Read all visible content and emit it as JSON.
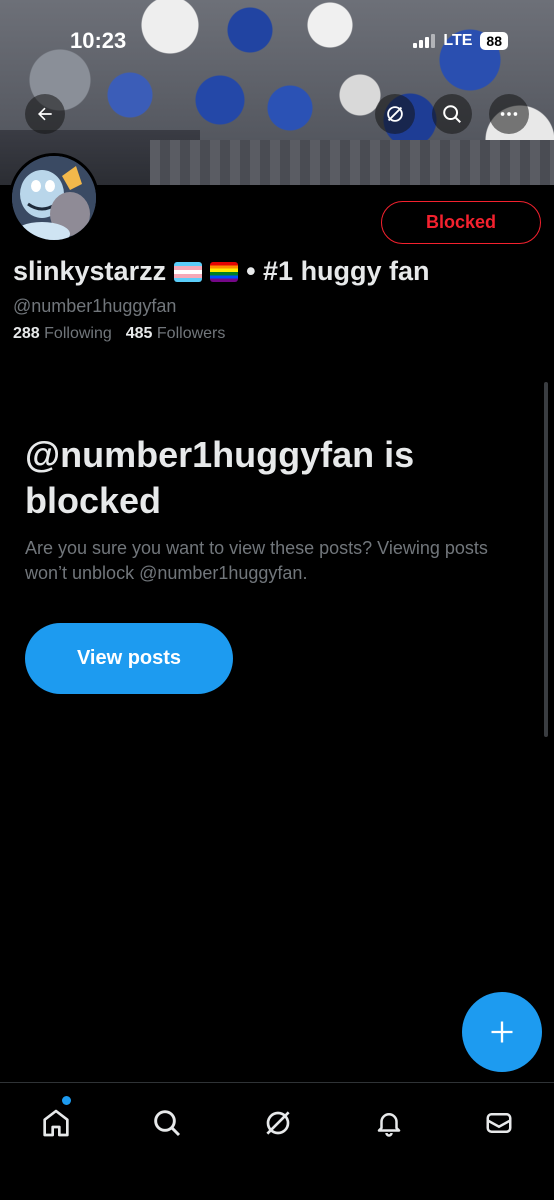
{
  "status_bar": {
    "time": "10:23",
    "network": "LTE",
    "battery": "88"
  },
  "header": {
    "back_icon": "arrow-left-icon",
    "grok_icon": "grok-slash-icon",
    "search_icon": "search-icon",
    "more_icon": "more-horizontal-icon"
  },
  "profile": {
    "display_name": "slinkystarzz",
    "name_suffix": "• #1 huggy fan",
    "flags": [
      "transgender-flag",
      "rainbow-flag"
    ],
    "handle": "@number1huggyfan",
    "following_count": "288",
    "following_label": "Following",
    "followers_count": "485",
    "followers_label": "Followers",
    "blocked_button": "Blocked"
  },
  "blocked_notice": {
    "title": "@number1huggyfan is blocked",
    "subtitle": "Are you sure you want to view these posts? Viewing posts won’t unblock @number1huggyfan.",
    "button": "View posts"
  },
  "fab": {
    "icon": "plus-icon"
  },
  "bottom_nav": {
    "items": [
      "home-icon",
      "search-icon",
      "grok-slash-icon",
      "bell-icon",
      "mail-icon"
    ],
    "home_has_dot": true
  },
  "colors": {
    "accent": "#1d9bf0",
    "danger": "#f4212e",
    "text": "#e7e9ea",
    "muted": "#71767b",
    "background": "#000000"
  }
}
